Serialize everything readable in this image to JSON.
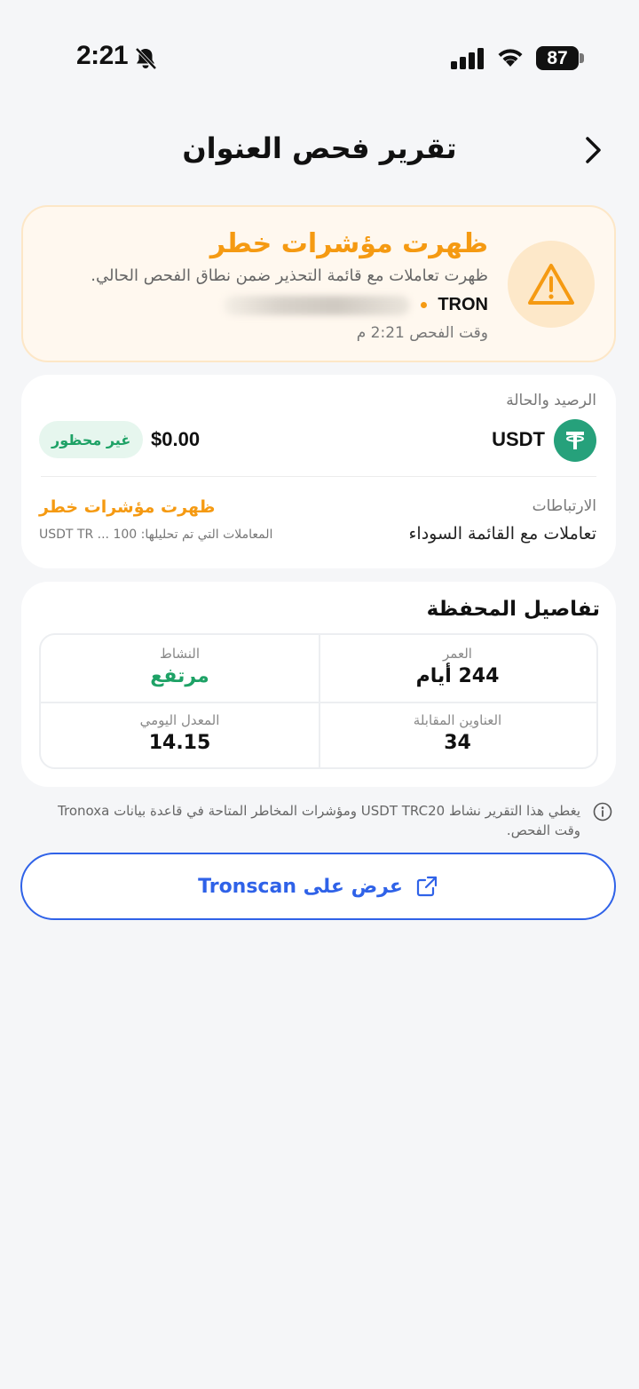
{
  "status_bar": {
    "time": "2:21",
    "battery": "87"
  },
  "header": {
    "title": "تقرير فحص العنوان"
  },
  "alert": {
    "title": "ظهرت مؤشرات خطر",
    "description": "ظهرت تعاملات مع قائمة التحذير ضمن نطاق الفحص الحالي.",
    "chain": "TRON",
    "scan_time": "وقت الفحص 2:21 م"
  },
  "balance": {
    "section_label": "الرصيد والحالة",
    "token": "USDT",
    "amount": "$0.00",
    "status_badge": "غير محظور",
    "links_label": "الارتباطات",
    "links_value": "تعاملات مع القائمة السوداء",
    "risk_text": "ظهرت مؤشرات خطر",
    "transactions_analyzed": "المعاملات التي تم تحليلها: 100 ... USDT TR"
  },
  "wallet": {
    "title": "تفاصيل المحفظة",
    "cells": [
      {
        "label": "العمر",
        "value": "244 أيام"
      },
      {
        "label": "النشاط",
        "value": "مرتفع"
      },
      {
        "label": "العناوين المقابلة",
        "value": "34"
      },
      {
        "label": "المعدل اليومي",
        "value": "14.15"
      }
    ]
  },
  "disclaimer": "يغطي هذا التقرير نشاط USDT TRC20 ومؤشرات المخاطر المتاحة في قاعدة بيانات Tronoxa وقت الفحص.",
  "tronscan_button": "عرض على Tronscan",
  "colors": {
    "accent": "#2f62e8",
    "warning": "#f59a12",
    "success": "#1ea266",
    "tether": "#26a17b"
  }
}
